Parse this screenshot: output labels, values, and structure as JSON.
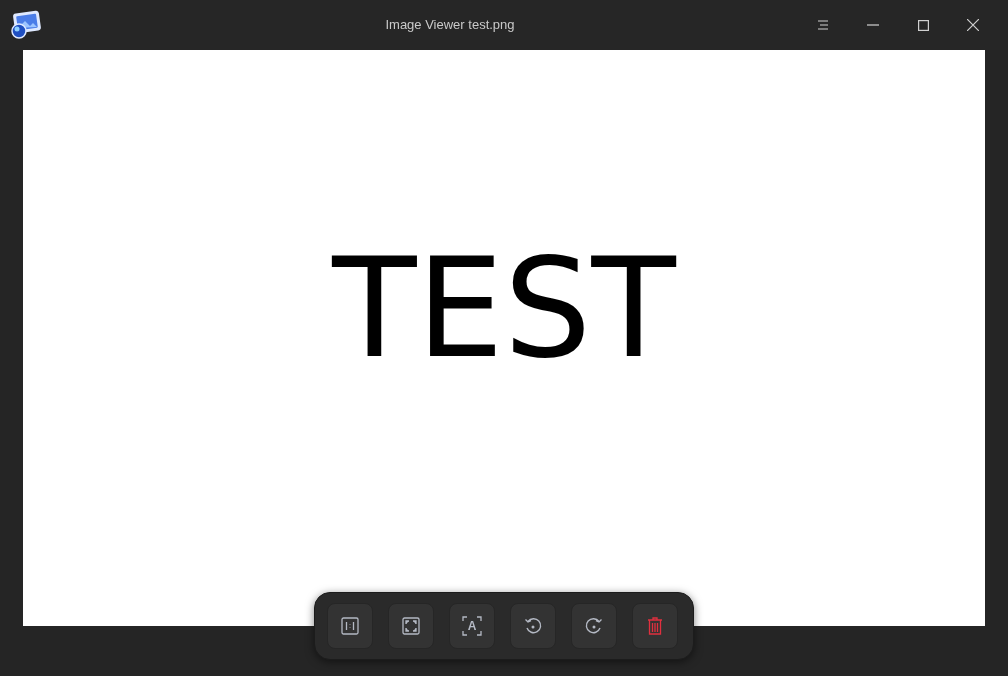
{
  "window": {
    "title": "Image Viewer test.png"
  },
  "image": {
    "text": "TEST"
  },
  "toolbar": [
    {
      "kind": "actual-size"
    },
    {
      "kind": "fit"
    },
    {
      "kind": "ocr",
      "label": "A"
    },
    {
      "kind": "rotate-left"
    },
    {
      "kind": "rotate-right"
    },
    {
      "kind": "delete"
    }
  ]
}
